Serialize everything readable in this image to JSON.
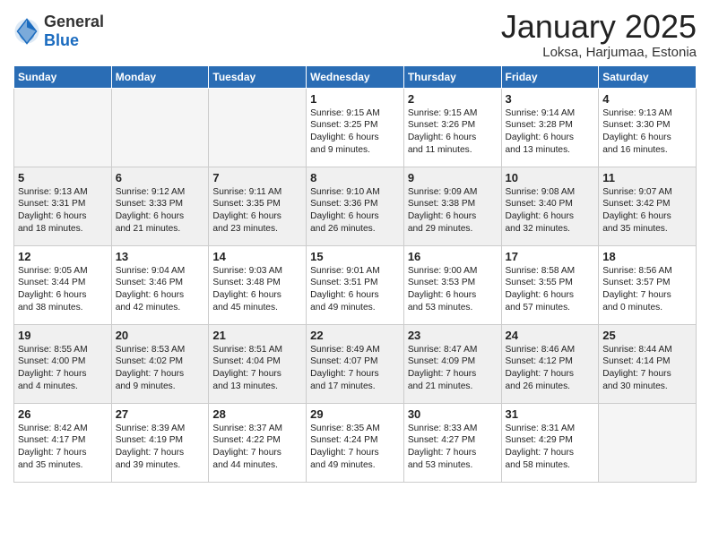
{
  "header": {
    "logo_general": "General",
    "logo_blue": "Blue",
    "month_year": "January 2025",
    "location": "Loksa, Harjumaa, Estonia"
  },
  "weekdays": [
    "Sunday",
    "Monday",
    "Tuesday",
    "Wednesday",
    "Thursday",
    "Friday",
    "Saturday"
  ],
  "weeks": [
    [
      {
        "day": "",
        "content": ""
      },
      {
        "day": "",
        "content": ""
      },
      {
        "day": "",
        "content": ""
      },
      {
        "day": "1",
        "content": "Sunrise: 9:15 AM\nSunset: 3:25 PM\nDaylight: 6 hours\nand 9 minutes."
      },
      {
        "day": "2",
        "content": "Sunrise: 9:15 AM\nSunset: 3:26 PM\nDaylight: 6 hours\nand 11 minutes."
      },
      {
        "day": "3",
        "content": "Sunrise: 9:14 AM\nSunset: 3:28 PM\nDaylight: 6 hours\nand 13 minutes."
      },
      {
        "day": "4",
        "content": "Sunrise: 9:13 AM\nSunset: 3:30 PM\nDaylight: 6 hours\nand 16 minutes."
      }
    ],
    [
      {
        "day": "5",
        "content": "Sunrise: 9:13 AM\nSunset: 3:31 PM\nDaylight: 6 hours\nand 18 minutes."
      },
      {
        "day": "6",
        "content": "Sunrise: 9:12 AM\nSunset: 3:33 PM\nDaylight: 6 hours\nand 21 minutes."
      },
      {
        "day": "7",
        "content": "Sunrise: 9:11 AM\nSunset: 3:35 PM\nDaylight: 6 hours\nand 23 minutes."
      },
      {
        "day": "8",
        "content": "Sunrise: 9:10 AM\nSunset: 3:36 PM\nDaylight: 6 hours\nand 26 minutes."
      },
      {
        "day": "9",
        "content": "Sunrise: 9:09 AM\nSunset: 3:38 PM\nDaylight: 6 hours\nand 29 minutes."
      },
      {
        "day": "10",
        "content": "Sunrise: 9:08 AM\nSunset: 3:40 PM\nDaylight: 6 hours\nand 32 minutes."
      },
      {
        "day": "11",
        "content": "Sunrise: 9:07 AM\nSunset: 3:42 PM\nDaylight: 6 hours\nand 35 minutes."
      }
    ],
    [
      {
        "day": "12",
        "content": "Sunrise: 9:05 AM\nSunset: 3:44 PM\nDaylight: 6 hours\nand 38 minutes."
      },
      {
        "day": "13",
        "content": "Sunrise: 9:04 AM\nSunset: 3:46 PM\nDaylight: 6 hours\nand 42 minutes."
      },
      {
        "day": "14",
        "content": "Sunrise: 9:03 AM\nSunset: 3:48 PM\nDaylight: 6 hours\nand 45 minutes."
      },
      {
        "day": "15",
        "content": "Sunrise: 9:01 AM\nSunset: 3:51 PM\nDaylight: 6 hours\nand 49 minutes."
      },
      {
        "day": "16",
        "content": "Sunrise: 9:00 AM\nSunset: 3:53 PM\nDaylight: 6 hours\nand 53 minutes."
      },
      {
        "day": "17",
        "content": "Sunrise: 8:58 AM\nSunset: 3:55 PM\nDaylight: 6 hours\nand 57 minutes."
      },
      {
        "day": "18",
        "content": "Sunrise: 8:56 AM\nSunset: 3:57 PM\nDaylight: 7 hours\nand 0 minutes."
      }
    ],
    [
      {
        "day": "19",
        "content": "Sunrise: 8:55 AM\nSunset: 4:00 PM\nDaylight: 7 hours\nand 4 minutes."
      },
      {
        "day": "20",
        "content": "Sunrise: 8:53 AM\nSunset: 4:02 PM\nDaylight: 7 hours\nand 9 minutes."
      },
      {
        "day": "21",
        "content": "Sunrise: 8:51 AM\nSunset: 4:04 PM\nDaylight: 7 hours\nand 13 minutes."
      },
      {
        "day": "22",
        "content": "Sunrise: 8:49 AM\nSunset: 4:07 PM\nDaylight: 7 hours\nand 17 minutes."
      },
      {
        "day": "23",
        "content": "Sunrise: 8:47 AM\nSunset: 4:09 PM\nDaylight: 7 hours\nand 21 minutes."
      },
      {
        "day": "24",
        "content": "Sunrise: 8:46 AM\nSunset: 4:12 PM\nDaylight: 7 hours\nand 26 minutes."
      },
      {
        "day": "25",
        "content": "Sunrise: 8:44 AM\nSunset: 4:14 PM\nDaylight: 7 hours\nand 30 minutes."
      }
    ],
    [
      {
        "day": "26",
        "content": "Sunrise: 8:42 AM\nSunset: 4:17 PM\nDaylight: 7 hours\nand 35 minutes."
      },
      {
        "day": "27",
        "content": "Sunrise: 8:39 AM\nSunset: 4:19 PM\nDaylight: 7 hours\nand 39 minutes."
      },
      {
        "day": "28",
        "content": "Sunrise: 8:37 AM\nSunset: 4:22 PM\nDaylight: 7 hours\nand 44 minutes."
      },
      {
        "day": "29",
        "content": "Sunrise: 8:35 AM\nSunset: 4:24 PM\nDaylight: 7 hours\nand 49 minutes."
      },
      {
        "day": "30",
        "content": "Sunrise: 8:33 AM\nSunset: 4:27 PM\nDaylight: 7 hours\nand 53 minutes."
      },
      {
        "day": "31",
        "content": "Sunrise: 8:31 AM\nSunset: 4:29 PM\nDaylight: 7 hours\nand 58 minutes."
      },
      {
        "day": "",
        "content": ""
      }
    ]
  ]
}
